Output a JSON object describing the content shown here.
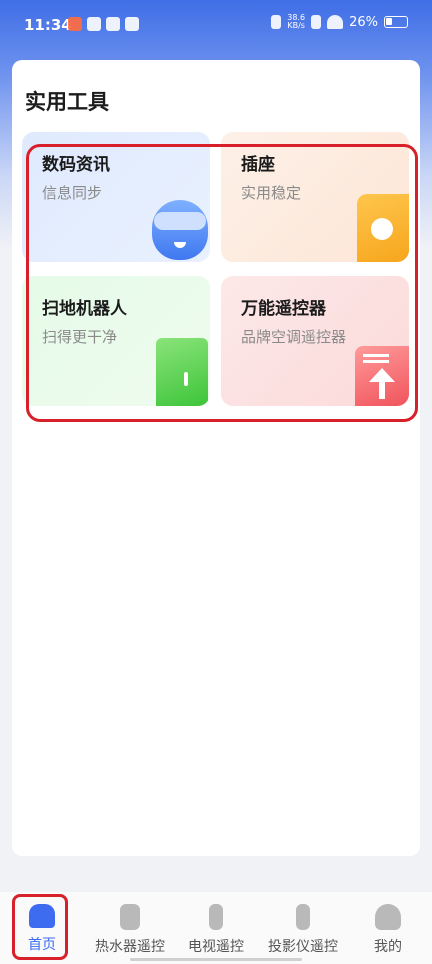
{
  "status_bar": {
    "time": "11:34",
    "net_speed": "38.6",
    "net_unit": "KB/s",
    "battery": "26%"
  },
  "main": {
    "section_title": "实用工具",
    "tiles": [
      {
        "title": "数码资讯",
        "subtitle": "信息同步",
        "icon": "robot-icon"
      },
      {
        "title": "插座",
        "subtitle": "实用稳定",
        "icon": "plug-icon"
      },
      {
        "title": "扫地机器人",
        "subtitle": "扫得更干净",
        "icon": "door-icon"
      },
      {
        "title": "万能遥控器",
        "subtitle": "品牌空调遥控器",
        "icon": "remote-icon"
      }
    ]
  },
  "bottom_nav": {
    "items": [
      {
        "label": "首页",
        "icon": "home-icon",
        "active": true
      },
      {
        "label": "热水器遥控",
        "icon": "water-heater-icon"
      },
      {
        "label": "电视遥控",
        "icon": "tv-remote-icon"
      },
      {
        "label": "投影仪遥控",
        "icon": "projector-remote-icon"
      },
      {
        "label": "我的",
        "icon": "user-icon"
      }
    ]
  },
  "colors": {
    "accent": "#3d6cf0",
    "highlight": "#d8202a"
  }
}
